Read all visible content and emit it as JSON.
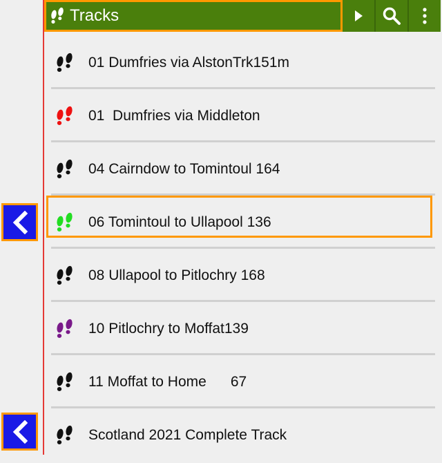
{
  "toolbar": {
    "title": "Tracks",
    "colors": {
      "bar": "#4a7f0c",
      "highlight": "#ff9800"
    },
    "icons": [
      "footprints-icon",
      "play-icon",
      "search-icon",
      "more-vert-icon"
    ]
  },
  "side": {
    "line_color": "#e53935",
    "buttons": [
      {
        "icon": "chevron-left-icon"
      },
      {
        "icon": "chevron-left-icon"
      }
    ]
  },
  "tracks": [
    {
      "label": "01 Dumfries via AlstonTrk151m",
      "color": "#111111"
    },
    {
      "label": "01  Dumfries via Middleton",
      "color": "#ee1111"
    },
    {
      "label": "04 Cairndow to Tomintoul 164",
      "color": "#111111"
    },
    {
      "label": "06 Tomintoul to Ullapool 136",
      "color": "#22dd22",
      "selected": true
    },
    {
      "label": "08 Ullapool to Pitlochry 168",
      "color": "#111111"
    },
    {
      "label": "10 Pitlochry to Moffat139",
      "color": "#7a1a8a"
    },
    {
      "label": "11 Moffat to Home      67",
      "color": "#111111"
    },
    {
      "label": "Scotland 2021 Complete Track",
      "color": "#111111"
    }
  ]
}
